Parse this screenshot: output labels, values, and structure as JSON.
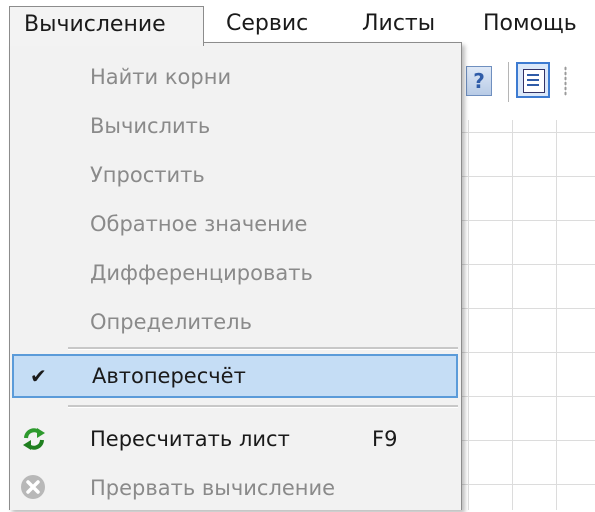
{
  "menubar": {
    "items": [
      "Вычисление",
      "Сервис",
      "Листы",
      "Помощь"
    ]
  },
  "toolbar": {
    "help_glyph": "?"
  },
  "dropdown": {
    "items": [
      {
        "label": "Найти корни",
        "enabled": false
      },
      {
        "label": "Вычислить",
        "enabled": false
      },
      {
        "label": "Упростить",
        "enabled": false
      },
      {
        "label": "Обратное значение",
        "enabled": false
      },
      {
        "label": "Дифференцировать",
        "enabled": false
      },
      {
        "label": "Определитель",
        "enabled": false
      },
      {
        "label": "Автопересчёт",
        "enabled": true,
        "checked": true,
        "highlighted": true
      },
      {
        "label": "Пересчитать лист",
        "shortcut": "F9",
        "enabled": true,
        "icon": "recalculate-icon"
      },
      {
        "label": "Прервать вычисление",
        "enabled": false,
        "icon": "stop-icon"
      }
    ],
    "check_glyph": "✔"
  },
  "colors": {
    "highlight_bg": "#c5ddf5",
    "highlight_border": "#5b9bd9",
    "menu_bg": "#f2f2f2",
    "disabled_text": "#8a8a8a",
    "enabled_text": "#1a1a1a"
  }
}
